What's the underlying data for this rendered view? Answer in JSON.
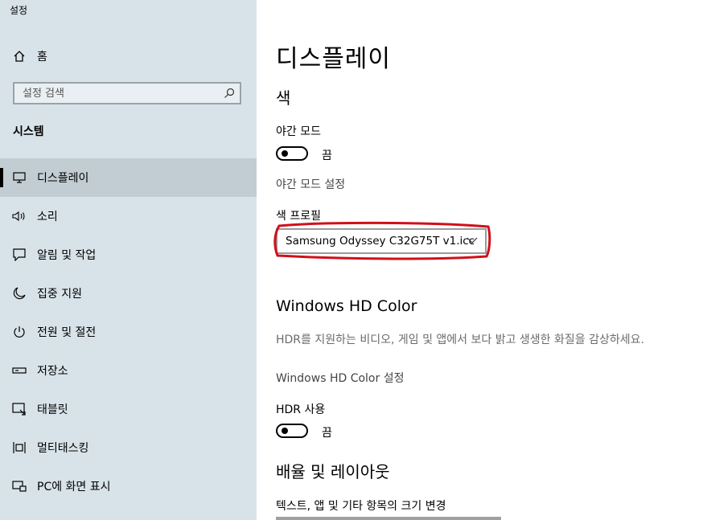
{
  "app_title": "설정",
  "home": {
    "label": "홈",
    "icon": "home-icon"
  },
  "search": {
    "placeholder": "설정 검색",
    "icon": "search-icon"
  },
  "sidebar": {
    "section_title": "시스템",
    "items": [
      {
        "label": "디스플레이",
        "icon": "monitor-icon",
        "selected": true
      },
      {
        "label": "소리",
        "icon": "speaker-icon"
      },
      {
        "label": "알림 및 작업",
        "icon": "message-icon"
      },
      {
        "label": "집중 지원",
        "icon": "moon-icon"
      },
      {
        "label": "전원 및 절전",
        "icon": "power-icon"
      },
      {
        "label": "저장소",
        "icon": "storage-icon"
      },
      {
        "label": "태블릿",
        "icon": "tablet-icon"
      },
      {
        "label": "멀티태스킹",
        "icon": "multitasking-icon"
      },
      {
        "label": "PC에 화면 표시",
        "icon": "project-icon"
      }
    ]
  },
  "main": {
    "title": "디스플레이",
    "color_heading": "색",
    "night_mode": {
      "label": "야간 모드",
      "state": "끔",
      "on": false
    },
    "night_mode_settings": "야간 모드 설정",
    "color_profile": {
      "label": "색 프로필",
      "value": "Samsung Odyssey C32G75T v1.icc"
    },
    "hd_color": {
      "heading": "Windows HD Color",
      "description": "HDR를 지원하는 비디오, 게임 및 앱에서 보다 밝고 생생한 화질을 감상하세요.",
      "settings_link": "Windows HD Color 설정"
    },
    "hdr": {
      "label": "HDR 사용",
      "state": "끔",
      "on": false
    },
    "scale": {
      "heading": "배율 및 레이아웃",
      "label": "텍스트, 앱 및 기타 항목의 크기 변경"
    }
  },
  "colors": {
    "sidebar_bg": "#d8e3e9",
    "selected_bg": "#c2cdd3",
    "annotation": "#d0101a"
  }
}
